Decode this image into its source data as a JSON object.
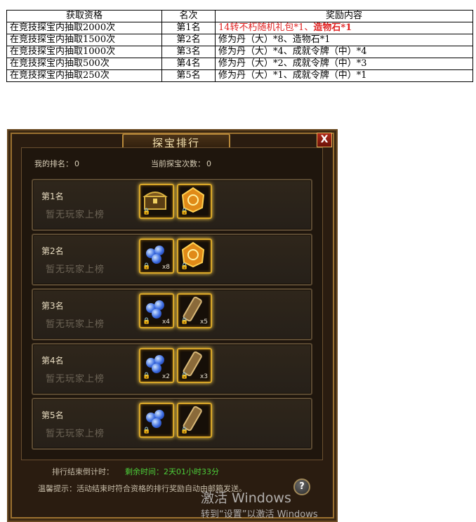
{
  "table": {
    "headers": [
      "获取资格",
      "名次",
      "奖励内容"
    ],
    "rows": [
      {
        "condition": "在竞技探宝内抽取2000次",
        "rank": "第1名",
        "reward": "14转不朽随机礼包*1、",
        "reward_bold": "造物石*1"
      },
      {
        "condition": "在竞技探宝内抽取1500次",
        "rank": "第2名",
        "reward": "修为丹（大）*8、造物石*1"
      },
      {
        "condition": "在竞技探宝内抽取1000次",
        "rank": "第3名",
        "reward": "修为丹（大）*4、成就令牌（中）*4"
      },
      {
        "condition": "在竞技探宝内抽取500次",
        "rank": "第4名",
        "reward": "修为丹（大）*2、成就令牌（中）*3"
      },
      {
        "condition": "在竞技探宝内抽取250次",
        "rank": "第5名",
        "reward": "修为丹（大）*1、成就令牌（中）*1"
      }
    ],
    "highlight_color": "#e02020"
  },
  "window": {
    "title": "探宝排行",
    "close_label": "X",
    "my_rank_label": "我的排名：",
    "my_rank_value": "0",
    "count_label": "当前探宝次数：",
    "count_value": "0",
    "ranks": [
      {
        "label": "第1名",
        "empty": "暂无玩家上榜",
        "items": [
          {
            "icon": "treasure-chest-icon",
            "count": ""
          },
          {
            "icon": "forge-stone-icon",
            "count": ""
          }
        ]
      },
      {
        "label": "第2名",
        "empty": "暂无玩家上榜",
        "items": [
          {
            "icon": "pill-icon",
            "count": "x8"
          },
          {
            "icon": "forge-stone-icon",
            "count": ""
          }
        ]
      },
      {
        "label": "第3名",
        "empty": "暂无玩家上榜",
        "items": [
          {
            "icon": "pill-icon",
            "count": "x4"
          },
          {
            "icon": "token-icon",
            "count": "x5"
          }
        ]
      },
      {
        "label": "第4名",
        "empty": "暂无玩家上榜",
        "items": [
          {
            "icon": "pill-icon",
            "count": "x2"
          },
          {
            "icon": "token-icon",
            "count": "x3"
          }
        ]
      },
      {
        "label": "第5名",
        "empty": "暂无玩家上榜",
        "items": [
          {
            "icon": "pill-icon",
            "count": ""
          },
          {
            "icon": "token-icon",
            "count": ""
          }
        ]
      }
    ],
    "countdown_label": "排行结束倒计时：",
    "countdown_value": "剩余时间：2天01小时33分",
    "tip": "温馨提示：活动结束时符合资格的排行奖励自动由邮箱发送。",
    "help_label": "?"
  },
  "watermark": {
    "line1": "激活 Windows",
    "line2": "转到“设置”以激活 Windows"
  }
}
